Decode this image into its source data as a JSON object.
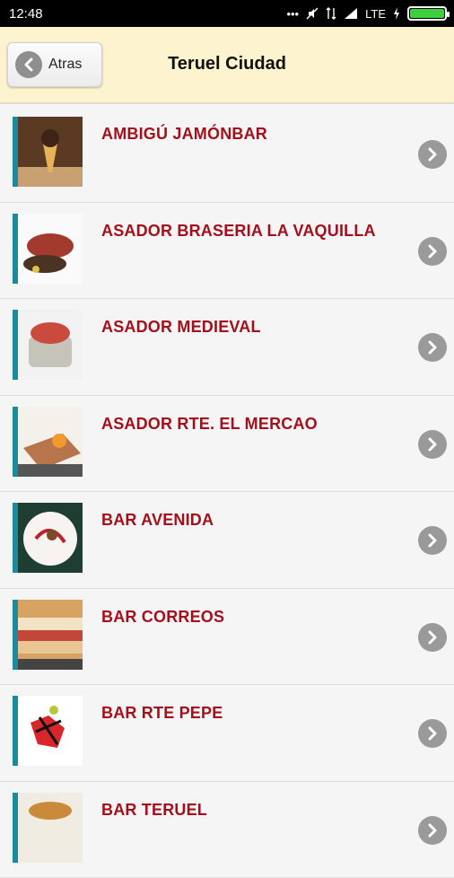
{
  "status": {
    "time": "12:48",
    "network": "LTE"
  },
  "header": {
    "back_label": "Atras",
    "title": "Teruel Ciudad"
  },
  "items": [
    {
      "label": "AMBIGÚ JAMÓNBAR"
    },
    {
      "label": "ASADOR BRASERIA LA VAQUILLA"
    },
    {
      "label": "ASADOR MEDIEVAL"
    },
    {
      "label": "ASADOR RTE. EL MERCAO"
    },
    {
      "label": "BAR AVENIDA"
    },
    {
      "label": "BAR CORREOS"
    },
    {
      "label": "BAR RTE PEPE"
    },
    {
      "label": "BAR TERUEL"
    }
  ]
}
